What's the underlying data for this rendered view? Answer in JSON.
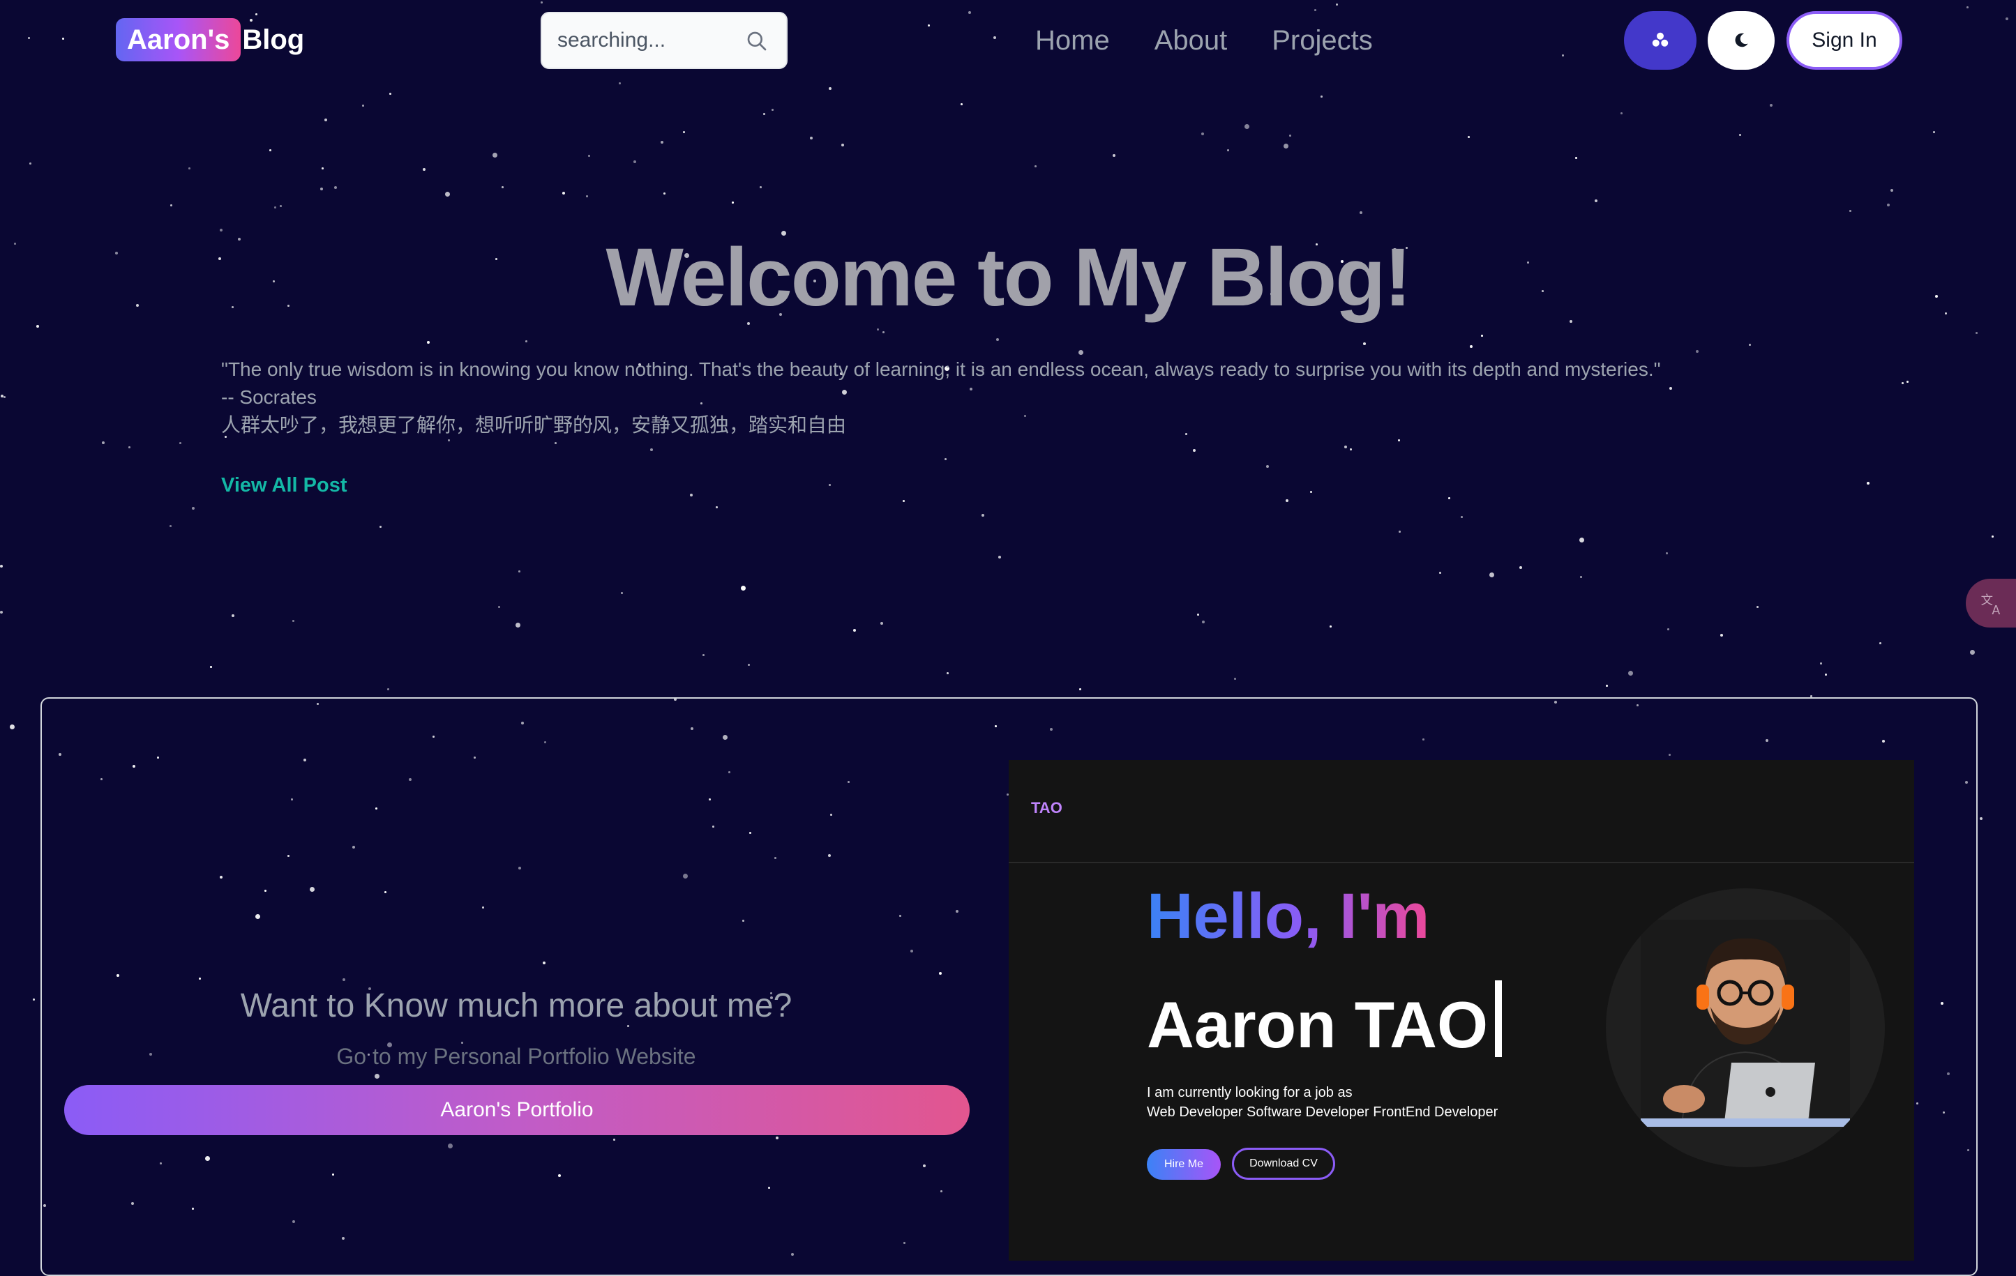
{
  "brand": {
    "highlight": "Aaron's",
    "rest": "Blog"
  },
  "search": {
    "placeholder": "searching..."
  },
  "nav": {
    "items": [
      "Home",
      "About",
      "Projects"
    ]
  },
  "header": {
    "sign_in": "Sign In"
  },
  "hero": {
    "title": "Welcome to My Blog!",
    "quote_line1": "\"The only true wisdom is in knowing you know nothing. That's the beauty of learning; it is an endless ocean, always ready to surprise you with its depth and mysteries.\"",
    "quote_line2": "-- Socrates",
    "quote_line3": "人群太吵了，我想更了解你，想听听旷野的风，安静又孤独，踏实和自由",
    "view_all": "View All Post"
  },
  "portfolio": {
    "heading": "Want to Know much more about me?",
    "subheading": "Go to my Personal Portfolio Website",
    "button": "Aaron's Portfolio"
  },
  "preview": {
    "logo": "TAO",
    "hello": "Hello, I'm",
    "name": "Aaron TAO",
    "job_line1": "I am currently looking for a job as",
    "job_line2": "Web Developer Software Developer FrontEnd Developer",
    "hire": "Hire Me",
    "download": "Download CV"
  },
  "colors": {
    "background": "#0a0733",
    "accent_teal": "#14b8a6",
    "accent_purple": "#8b5cf6",
    "accent_pink": "#ec4899",
    "theme_button": "#4338ca"
  },
  "icons": [
    "search-icon",
    "sparkle-icon",
    "moon-icon",
    "translate-icon",
    "avatar-illustration"
  ]
}
